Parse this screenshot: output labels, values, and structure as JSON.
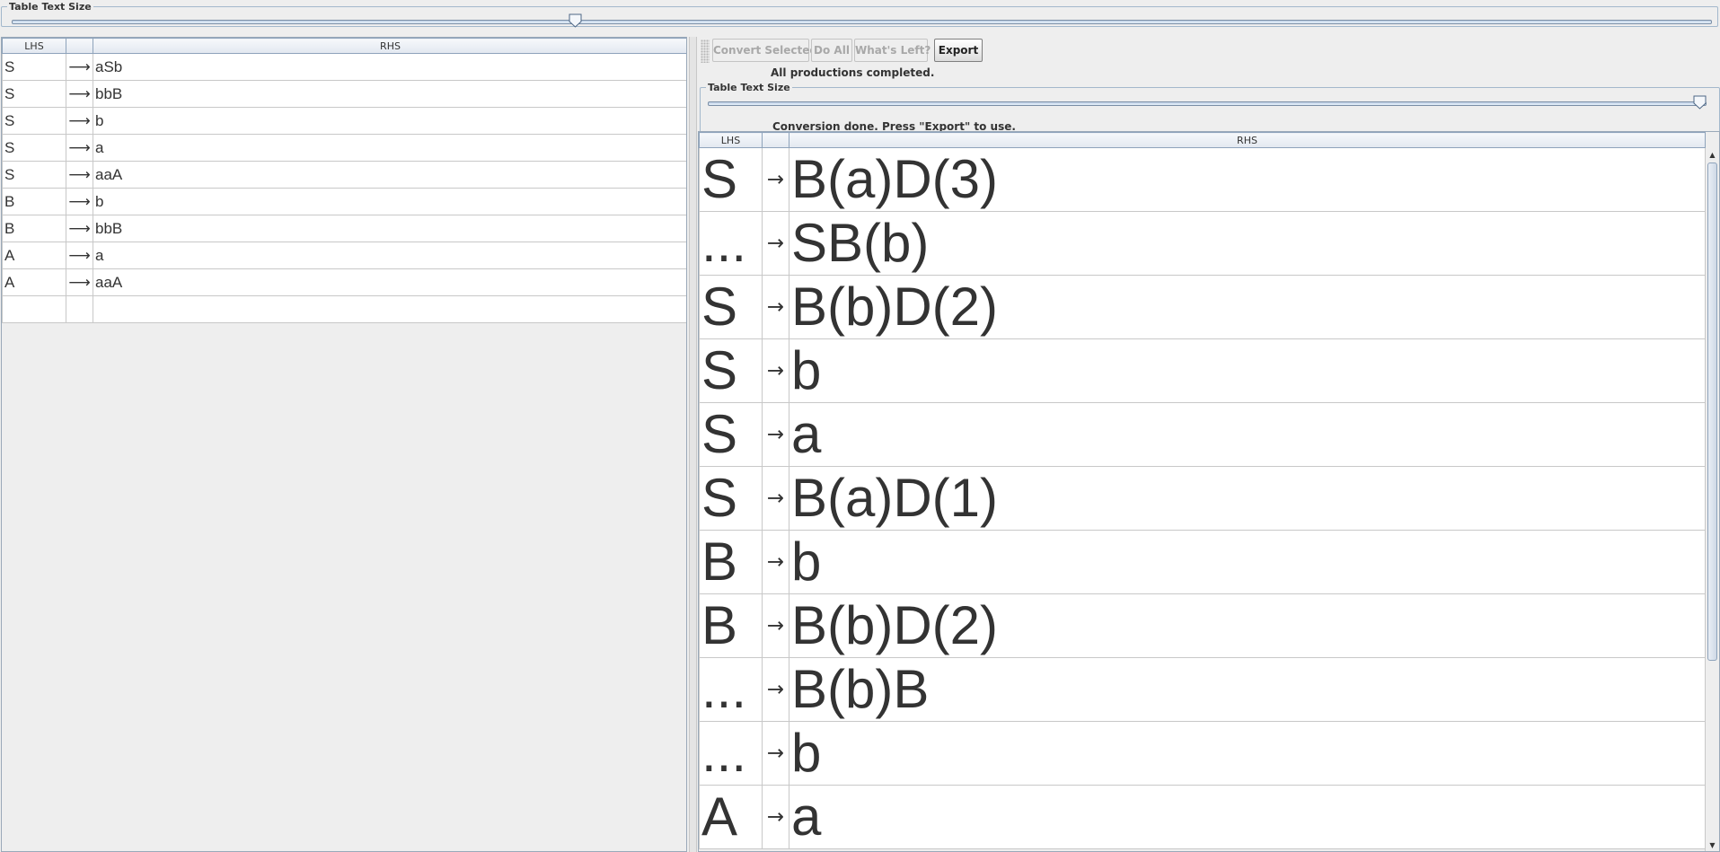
{
  "top_slider": {
    "title": "Table Text Size",
    "value": 0.33
  },
  "left_table": {
    "headers": [
      "LHS",
      "",
      "RHS"
    ],
    "rows": [
      {
        "lhs": "S",
        "arrow": "⟶",
        "rhs": "aSb"
      },
      {
        "lhs": "S",
        "arrow": "⟶",
        "rhs": "bbB"
      },
      {
        "lhs": "S",
        "arrow": "⟶",
        "rhs": "b"
      },
      {
        "lhs": "S",
        "arrow": "⟶",
        "rhs": "a"
      },
      {
        "lhs": "S",
        "arrow": "⟶",
        "rhs": "aaA"
      },
      {
        "lhs": "B",
        "arrow": "⟶",
        "rhs": "b"
      },
      {
        "lhs": "B",
        "arrow": "⟶",
        "rhs": "bbB"
      },
      {
        "lhs": "A",
        "arrow": "⟶",
        "rhs": "a"
      },
      {
        "lhs": "A",
        "arrow": "⟶",
        "rhs": "aaA"
      },
      {
        "lhs": "",
        "arrow": "",
        "rhs": ""
      }
    ]
  },
  "toolbar": {
    "convert_selected": "Convert Selected",
    "do_all": "Do All",
    "whats_left": "What's Left?",
    "export": "Export"
  },
  "status": {
    "productions": "All productions completed.",
    "conversion": "Conversion done.  Press \"Export\" to use."
  },
  "right_slider": {
    "title": "Table Text Size",
    "value": 1.0
  },
  "right_table": {
    "headers": [
      "LHS",
      "",
      "RHS"
    ],
    "rows": [
      {
        "lhs": "S",
        "arrow": "→",
        "rhs": "B(a)D(3)"
      },
      {
        "lhs": "...",
        "arrow": "→",
        "rhs": "SB(b)"
      },
      {
        "lhs": "S",
        "arrow": "→",
        "rhs": "B(b)D(2)"
      },
      {
        "lhs": "S",
        "arrow": "→",
        "rhs": "b"
      },
      {
        "lhs": "S",
        "arrow": "→",
        "rhs": "a"
      },
      {
        "lhs": "S",
        "arrow": "→",
        "rhs": "B(a)D(1)"
      },
      {
        "lhs": "B",
        "arrow": "→",
        "rhs": "b"
      },
      {
        "lhs": "B",
        "arrow": "→",
        "rhs": "B(b)D(2)"
      },
      {
        "lhs": "...",
        "arrow": "→",
        "rhs": "B(b)B"
      },
      {
        "lhs": "...",
        "arrow": "→",
        "rhs": "b"
      },
      {
        "lhs": "A",
        "arrow": "→",
        "rhs": "a"
      }
    ]
  },
  "icons": {
    "slider_thumb": "slider-thumb-icon",
    "scroll_up": "arrow-up-icon",
    "scroll_down": "arrow-down-icon",
    "toolbar_grip": "grip-icon"
  }
}
